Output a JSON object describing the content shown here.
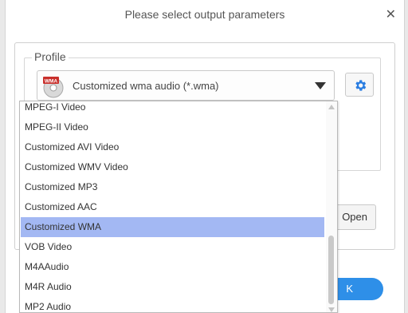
{
  "dialog": {
    "title": "Please select output parameters",
    "close_glyph": "✕"
  },
  "profile": {
    "legend": "Profile",
    "selected_value": "Customized wma audio (*.wma)",
    "icon_text": "WMA",
    "icon_name": "wma-file-icon",
    "settings_icon_name": "gear-icon"
  },
  "buttons": {
    "open_label": "Open",
    "ok_label": "K"
  },
  "dropdown": {
    "options": [
      "MPEG-I Video",
      "MPEG-II Video",
      "Customized AVI Video",
      "Customized WMV Video",
      "Customized MP3",
      "Customized AAC",
      "Customized WMA",
      "VOB Video",
      "M4AAudio",
      "M4R Audio",
      "MP2 Audio"
    ],
    "selected_index": 6
  },
  "colors": {
    "accent": "#2e8fe8",
    "selection": "#a3b8f3",
    "gear": "#2a7de1"
  }
}
